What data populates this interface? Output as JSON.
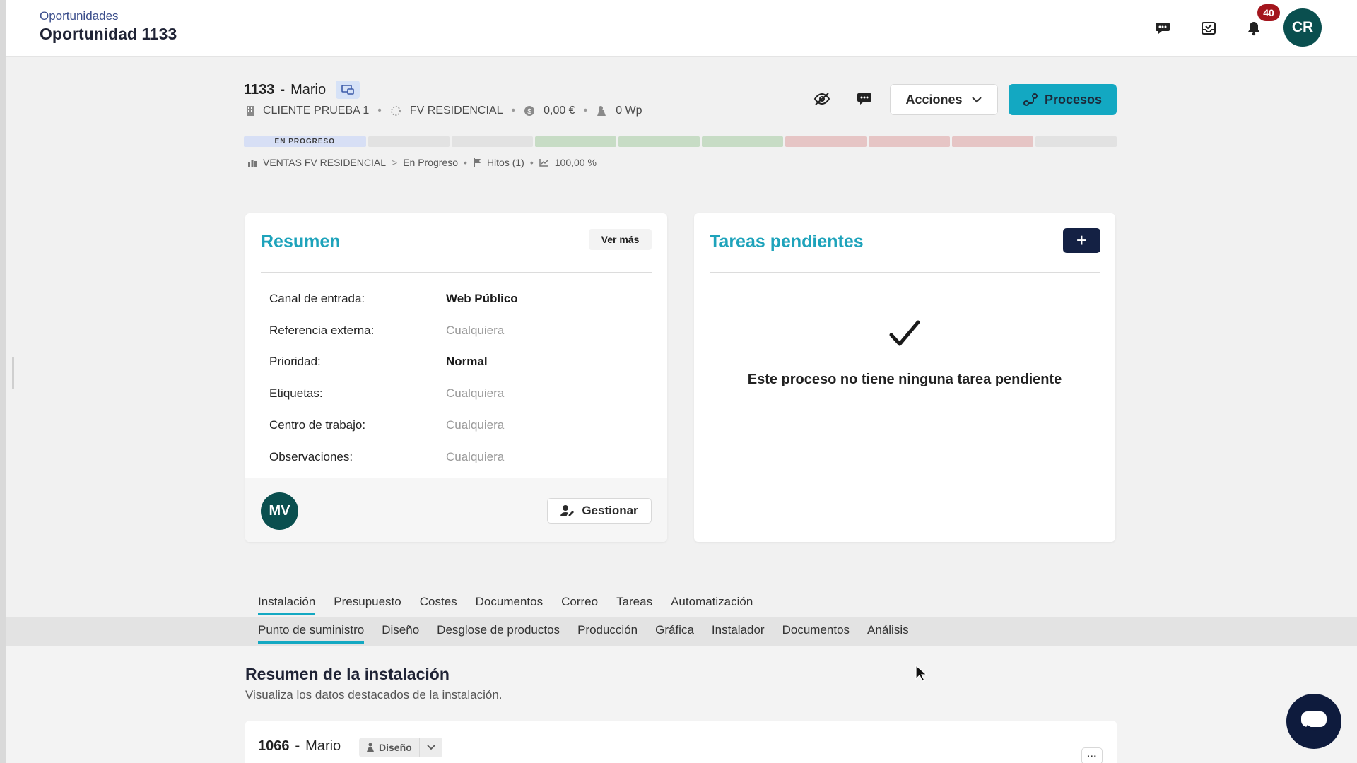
{
  "header": {
    "breadcrumb": "Oportunidades",
    "title": "Oportunidad 1133",
    "notification_count": "40",
    "user_initials": "CR",
    "icons": [
      "chat-icon",
      "inbox-icon",
      "bell-icon"
    ]
  },
  "opportunity": {
    "number": "1133",
    "dash": "-",
    "name": "Mario",
    "client": "CLIENTE PRUEBA 1",
    "type": "FV RESIDENCIAL",
    "amount": "0,00 €",
    "power": "0 Wp",
    "actions_label": "Acciones",
    "processes_label": "Procesos",
    "progress_label": "EN PROGRESO",
    "progress_colors": [
      "#d7dff5",
      "#e2e2e2",
      "#e2e2e2",
      "#c7dcc5",
      "#c7dcc5",
      "#c7dcc5",
      "#e6c5c5",
      "#e6c5c5",
      "#e6c5c5",
      "#e2e2e2"
    ]
  },
  "pipeline": {
    "name": "VENTAS FV RESIDENCIAL",
    "chevron": ">",
    "stage": "En Progreso",
    "milestones": "Hitos (1)",
    "percent": "100,00 %"
  },
  "summary": {
    "title": "Resumen",
    "see_more": "Ver más",
    "fields": [
      {
        "label": "Canal de entrada:",
        "value": "Web Público",
        "muted": false
      },
      {
        "label": "Referencia externa:",
        "value": "Cualquiera",
        "muted": true
      },
      {
        "label": "Prioridad:",
        "value": "Normal",
        "muted": false
      },
      {
        "label": "Etiquetas:",
        "value": "Cualquiera",
        "muted": true
      },
      {
        "label": "Centro de trabajo:",
        "value": "Cualquiera",
        "muted": true
      },
      {
        "label": "Observaciones:",
        "value": "Cualquiera",
        "muted": true
      }
    ],
    "assignee_initials": "MV",
    "manage_label": "Gestionar"
  },
  "tasks": {
    "title": "Tareas pendientes",
    "add_label": "+",
    "empty_message": "Este proceso no tiene ninguna tarea pendiente"
  },
  "tabs": [
    "Instalación",
    "Presupuesto",
    "Costes",
    "Documentos",
    "Correo",
    "Tareas",
    "Automatización"
  ],
  "subtabs": [
    "Punto de suministro",
    "Diseño",
    "Desglose de productos",
    "Producción",
    "Gráfica",
    "Instalador",
    "Documentos",
    "Análisis"
  ],
  "installation": {
    "section_title": "Resumen de la instalación",
    "section_subtitle": "Visualiza los datos destacados de la instalación.",
    "number": "1066",
    "dash": "-",
    "name": "Mario",
    "status": "Diseño",
    "more": "···"
  },
  "colors": {
    "accent": "#13a8c2",
    "title_accent": "#1ea3bb",
    "navy": "#142144",
    "avatar": "#0a4f4f",
    "badge": "#a3151d"
  }
}
